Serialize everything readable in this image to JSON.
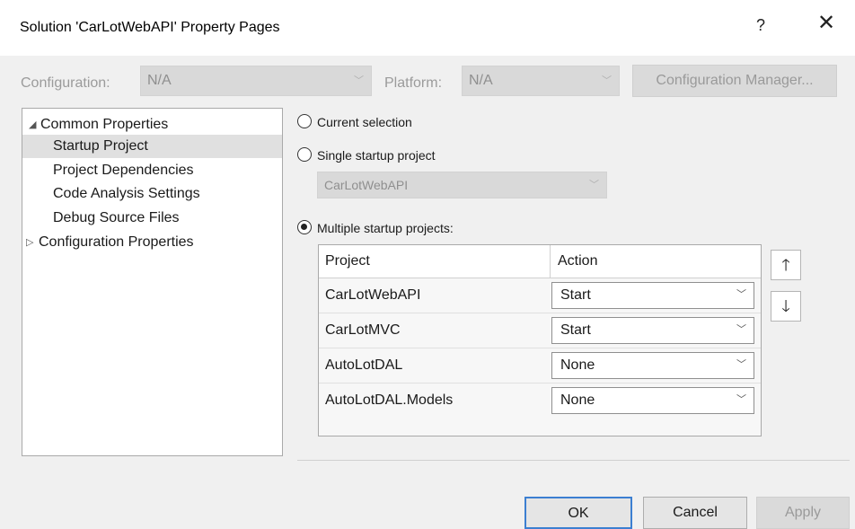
{
  "window": {
    "title": "Solution 'CarLotWebAPI' Property Pages",
    "help_glyph": "?",
    "close_glyph": "✕"
  },
  "config_bar": {
    "configuration_label": "Configuration:",
    "configuration_value": "N/A",
    "platform_label": "Platform:",
    "platform_value": "N/A",
    "config_manager_label": "Configuration Manager..."
  },
  "tree": {
    "items": [
      {
        "label": "Common Properties",
        "expanded": true
      },
      {
        "label": "Startup Project",
        "selected": true
      },
      {
        "label": "Project Dependencies"
      },
      {
        "label": "Code Analysis Settings"
      },
      {
        "label": "Debug Source Files"
      },
      {
        "label": "Configuration Properties",
        "expanded": false
      }
    ]
  },
  "startup": {
    "current_selection_label": "Current selection",
    "single_startup_label": "Single startup project",
    "single_startup_value": "CarLotWebAPI",
    "multiple_startup_label": "Multiple startup projects:",
    "selected_option": "multiple"
  },
  "grid": {
    "columns": [
      "Project",
      "Action"
    ],
    "rows": [
      {
        "project": "CarLotWebAPI",
        "action": "Start"
      },
      {
        "project": "CarLotMVC",
        "action": "Start"
      },
      {
        "project": "AutoLotDAL",
        "action": "None"
      },
      {
        "project": "AutoLotDAL.Models",
        "action": "None"
      }
    ]
  },
  "move_buttons": {
    "up_glyph": "🡑",
    "down_glyph": "🡓"
  },
  "footer": {
    "ok_label": "OK",
    "cancel_label": "Cancel",
    "apply_label": "Apply"
  },
  "colors": {
    "accent": "#3c7fd1",
    "selection_bg": "#e0e0e0",
    "dialog_bg": "#f0f0f0"
  }
}
